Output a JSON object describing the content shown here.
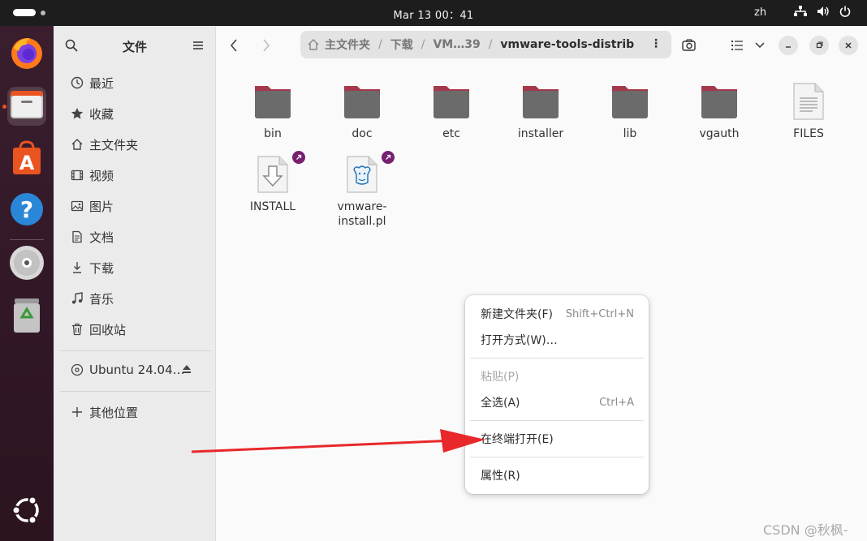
{
  "topbar": {
    "clock": "Mar 13  00：41",
    "language": "zh",
    "tray_icons": [
      "network-icon",
      "volume-icon",
      "power-icon"
    ]
  },
  "dock": {
    "items": [
      {
        "name": "Firefox",
        "icon": "firefox-icon"
      },
      {
        "name": "Files",
        "icon": "files-icon",
        "active": true
      },
      {
        "name": "App Center",
        "icon": "app-center-icon"
      },
      {
        "name": "Help",
        "icon": "help-icon"
      },
      {
        "name": "Disc",
        "icon": "disc-icon"
      },
      {
        "name": "Trash",
        "icon": "trash-icon"
      },
      {
        "name": "Show Apps",
        "icon": "ubuntu-icon"
      }
    ]
  },
  "sidebar": {
    "title": "文件",
    "places": [
      {
        "label": "最近",
        "icon": "clock-icon"
      },
      {
        "label": "收藏",
        "icon": "star-icon"
      },
      {
        "label": "主文件夹",
        "icon": "home-icon"
      },
      {
        "label": "视频",
        "icon": "video-icon"
      },
      {
        "label": "图片",
        "icon": "picture-icon"
      },
      {
        "label": "文档",
        "icon": "document-icon"
      },
      {
        "label": "下载",
        "icon": "download-icon"
      },
      {
        "label": "音乐",
        "icon": "music-icon"
      },
      {
        "label": "回收站",
        "icon": "trash-icon"
      }
    ],
    "devices": [
      {
        "label": "Ubuntu 24.04…",
        "icon": "disc-icon",
        "eject": "eject-icon"
      }
    ],
    "other_locations": {
      "label": "其他位置",
      "icon": "plus-icon"
    }
  },
  "pathbar": {
    "crumbs": [
      "主文件夹",
      "下载",
      "VM…39",
      "vmware-tools-distrib"
    ],
    "separator": "/",
    "more": "⋮"
  },
  "files": [
    {
      "name": "bin",
      "type": "folder"
    },
    {
      "name": "doc",
      "type": "folder"
    },
    {
      "name": "etc",
      "type": "folder"
    },
    {
      "name": "installer",
      "type": "folder"
    },
    {
      "name": "lib",
      "type": "folder"
    },
    {
      "name": "vgauth",
      "type": "folder"
    },
    {
      "name": "FILES",
      "type": "text"
    },
    {
      "name": "INSTALL",
      "type": "install",
      "link": true
    },
    {
      "name": "vmware-\ninstall.pl",
      "type": "perl",
      "link": true
    }
  ],
  "context_menu": {
    "items": [
      {
        "label": "新建文件夹(F)",
        "accel": "Shift+Ctrl+N"
      },
      {
        "label": "打开方式(W)…",
        "accel": ""
      },
      {
        "label": "粘贴(P)",
        "accel": "",
        "disabled": true
      },
      {
        "label": "全选(A)",
        "accel": "Ctrl+A"
      },
      {
        "label": "在终端打开(E)",
        "accel": ""
      },
      {
        "label": "属性(R)",
        "accel": ""
      }
    ]
  },
  "watermark": "CSDN @秋枫-",
  "colors": {
    "topbar": "#1d1d1d",
    "dock": "#2b1320",
    "accent": "#e95420",
    "folder": "#6b6b6b",
    "folder_tab": "#a3394b",
    "arrow": "#e8282b",
    "link_badge": "#77216f"
  }
}
